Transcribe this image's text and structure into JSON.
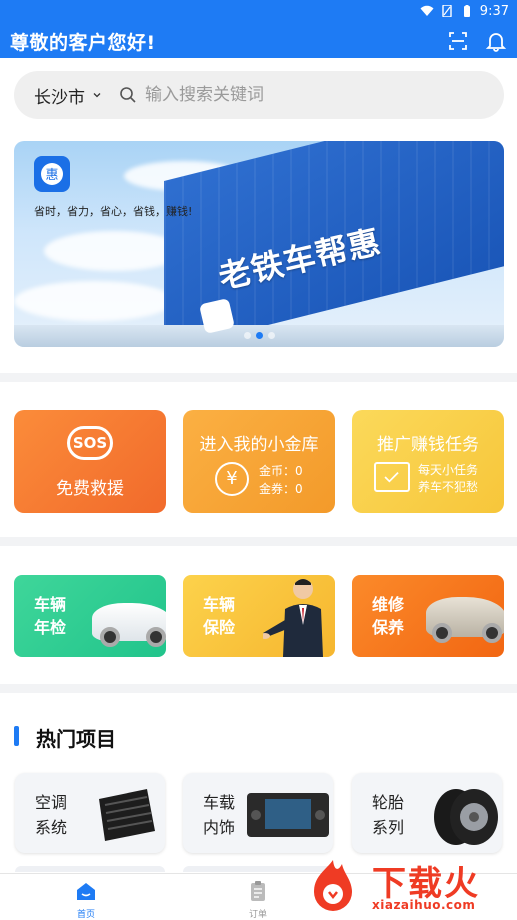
{
  "status_bar": {
    "time": "9:37"
  },
  "header": {
    "greeting": "尊敬的客户您好!"
  },
  "search": {
    "city": "长沙市",
    "placeholder": "输入搜索关键词"
  },
  "banner": {
    "slogan": "省时，省力，省心，省钱，赚钱!",
    "sign_text": "老铁车帮惠",
    "dot_count": 3,
    "active_dot": 1
  },
  "features": {
    "sos": {
      "badge": "SOS",
      "label": "免费救援"
    },
    "vault": {
      "title": "进入我的小金库",
      "coin_line": "金币：0",
      "voucher_line": "金券：0"
    },
    "task": {
      "title": "推广赚钱任务",
      "line1": "每天小任务",
      "line2": "养车不犯愁"
    }
  },
  "services": [
    {
      "label": "车辆年检"
    },
    {
      "label": "车辆保险"
    },
    {
      "label": "维修保养"
    }
  ],
  "hot": {
    "title": "热门项目",
    "items": [
      {
        "label": "空调系统"
      },
      {
        "label": "车载内饰"
      },
      {
        "label": "轮胎系列"
      }
    ]
  },
  "tabs": [
    {
      "label": "首页",
      "active": true
    },
    {
      "label": "订单",
      "active": false
    }
  ],
  "watermark": {
    "text": "下载火",
    "url": "xiazaihuo.com"
  },
  "colors": {
    "brand": "#1e7bf4",
    "watermark": "#ef3b24"
  }
}
